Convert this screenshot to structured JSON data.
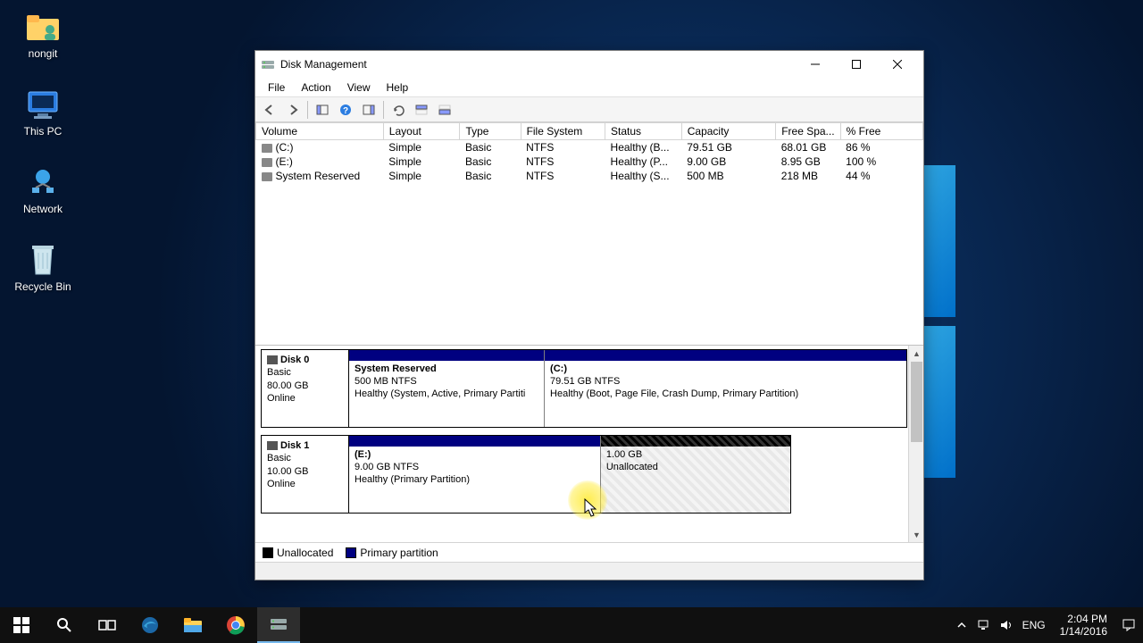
{
  "desktop_icons": [
    {
      "name": "nongit",
      "icon": "user"
    },
    {
      "name": "This PC",
      "icon": "pc"
    },
    {
      "name": "Network",
      "icon": "network"
    },
    {
      "name": "Recycle Bin",
      "icon": "recycle"
    }
  ],
  "window": {
    "title": "Disk Management",
    "menus": {
      "file": "File",
      "action": "Action",
      "view": "View",
      "help": "Help"
    }
  },
  "columns": {
    "volume": "Volume",
    "layout": "Layout",
    "type": "Type",
    "fs": "File System",
    "status": "Status",
    "capacity": "Capacity",
    "free": "Free Spa...",
    "pct": "% Free"
  },
  "volumes": [
    {
      "volume": "(C:)",
      "layout": "Simple",
      "type": "Basic",
      "fs": "NTFS",
      "status": "Healthy (B...",
      "capacity": "79.51 GB",
      "free": "68.01 GB",
      "pct": "86 %"
    },
    {
      "volume": "(E:)",
      "layout": "Simple",
      "type": "Basic",
      "fs": "NTFS",
      "status": "Healthy (P...",
      "capacity": "9.00 GB",
      "free": "8.95 GB",
      "pct": "100 %"
    },
    {
      "volume": "System Reserved",
      "layout": "Simple",
      "type": "Basic",
      "fs": "NTFS",
      "status": "Healthy (S...",
      "capacity": "500 MB",
      "free": "218 MB",
      "pct": "44 %"
    }
  ],
  "disks": [
    {
      "name": "Disk 0",
      "type": "Basic",
      "size": "80.00 GB",
      "state": "Online",
      "parts": [
        {
          "title": "System Reserved",
          "size": "500 MB NTFS",
          "status": "Healthy (System, Active, Primary Partiti",
          "weight": 35,
          "kind": "primary"
        },
        {
          "title": "(C:)",
          "size": "79.51 GB NTFS",
          "status": "Healthy (Boot, Page File, Crash Dump, Primary Partition)",
          "weight": 65,
          "kind": "primary"
        }
      ]
    },
    {
      "name": "Disk 1",
      "type": "Basic",
      "size": "10.00 GB",
      "state": "Online",
      "parts": [
        {
          "title": "(E:)",
          "size": "9.00 GB NTFS",
          "status": "Healthy (Primary Partition)",
          "weight": 57,
          "kind": "primary"
        },
        {
          "title": "",
          "size": "1.00 GB",
          "status": "Unallocated",
          "weight": 43,
          "kind": "unalloc"
        }
      ],
      "max_width_pct": 82
    }
  ],
  "legend": {
    "unalloc": "Unallocated",
    "primary": "Primary partition"
  },
  "taskbar": {
    "tray_lang": "ENG",
    "clock_time": "2:04 PM",
    "clock_date": "1/14/2016"
  }
}
